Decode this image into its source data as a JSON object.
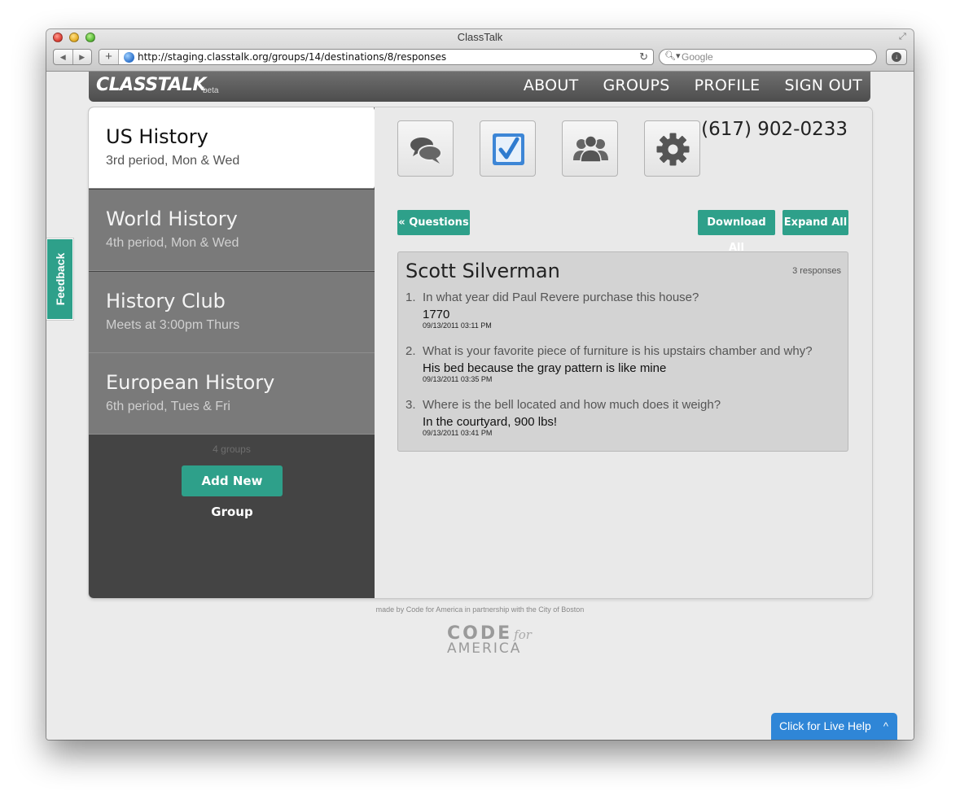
{
  "browser": {
    "window_title": "ClassTalk",
    "url": "http://staging.classtalk.org/groups/14/destinations/8/responses",
    "search_placeholder": "Google"
  },
  "header": {
    "logo": "CLASSTALK",
    "logo_suffix": "beta",
    "nav": [
      "ABOUT",
      "GROUPS",
      "PROFILE",
      "SIGN OUT"
    ]
  },
  "sidebar": {
    "groups": [
      {
        "name": "US History",
        "subtitle": "3rd period, Mon & Wed",
        "active": true
      },
      {
        "name": "World History",
        "subtitle": "4th period, Mon & Wed",
        "active": false
      },
      {
        "name": "History Club",
        "subtitle": "Meets at 3:00pm Thurs",
        "active": false
      },
      {
        "name": "European History",
        "subtitle": "6th period, Tues & Fri",
        "active": false
      }
    ],
    "group_count": "4 groups",
    "add_button": "Add New Group"
  },
  "toolbar": {
    "icons": [
      "conversation-icon",
      "checkbox-icon",
      "people-icon",
      "gear-icon"
    ],
    "phone": "(617) 902-0233"
  },
  "actions": {
    "back": "« Questions",
    "download_all": "Download All",
    "expand_all": "Expand All"
  },
  "response": {
    "name": "Scott Silverman",
    "count": "3 responses",
    "items": [
      {
        "num": "1.",
        "question": "In what year did Paul Revere purchase this house?",
        "answer": "1770",
        "timestamp": "09/13/2011 03:11 PM"
      },
      {
        "num": "2.",
        "question": "What is your favorite piece of furniture is his upstairs chamber and why?",
        "answer": "His bed because the gray pattern is like mine",
        "timestamp": "09/13/2011 03:35 PM"
      },
      {
        "num": "3.",
        "question": "Where is the bell located and how much does it weigh?",
        "answer": "In the courtyard, 900 lbs!",
        "timestamp": "09/13/2011 03:41 PM"
      }
    ]
  },
  "feedback": "Feedback",
  "footer": {
    "credit": "made by Code for America in partnership with the City of Boston",
    "logo_code": "CODE",
    "logo_for": "for",
    "logo_america": "AMERICA"
  },
  "live_help": "Click for Live Help",
  "colors": {
    "accent": "#2ea08a",
    "live_help": "#2f86d7"
  }
}
